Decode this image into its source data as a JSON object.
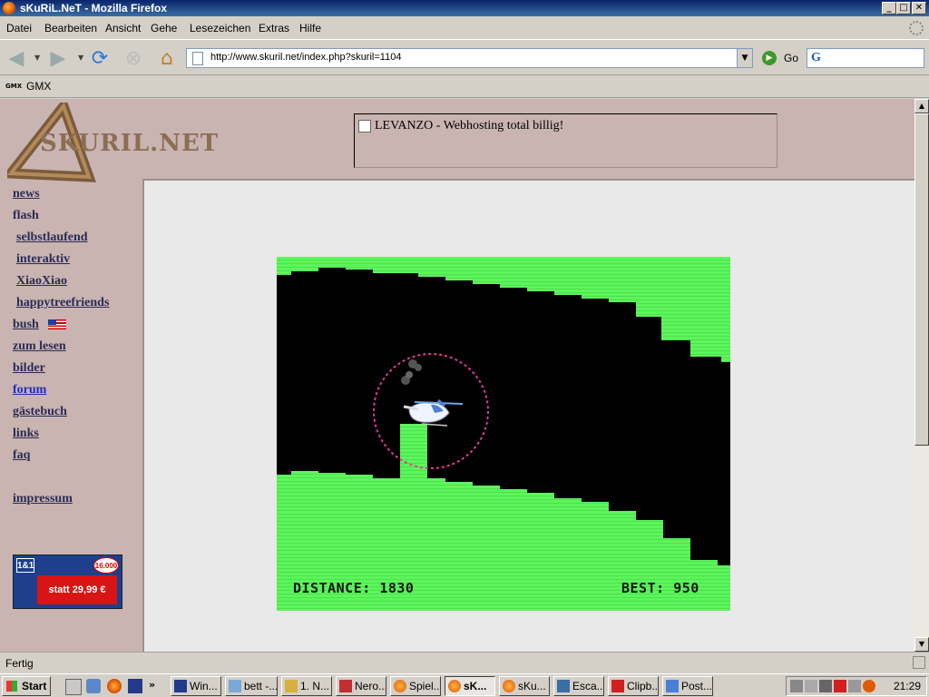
{
  "window": {
    "title": "sKuRiL.NeT - Mozilla Firefox",
    "buttons": {
      "minimize": "_",
      "maximize": "□",
      "close": "✕"
    }
  },
  "menu": [
    "Datei",
    "Bearbeiten",
    "Ansicht",
    "Gehe",
    "Lesezeichen",
    "Extras",
    "Hilfe"
  ],
  "toolbar": {
    "url": "http://www.skuril.net/index.php?skuril=1104",
    "go_label": "Go"
  },
  "bookmarks": {
    "icon_text": "GMX",
    "label": "GMX"
  },
  "page": {
    "logo_text": "SKURIL.NET",
    "ad_text": "LEVANZO - Webhosting total billig!",
    "nav": [
      "news",
      "flash",
      "selbstlaufend",
      "interaktiv",
      "XiaoXiao",
      "happytreefriends",
      "bush",
      "zum lesen",
      "bilder",
      "forum",
      "gästebuch",
      "links",
      "faq",
      "impressum"
    ],
    "ad_box": {
      "logo": "1&1",
      "badge": "16.000",
      "price": "statt 29,99 €"
    },
    "game": {
      "distance_label": "DISTANCE:",
      "distance_value": "1830",
      "best_label": "BEST:",
      "best_value": "950"
    }
  },
  "status": {
    "text": "Fertig"
  },
  "taskbar": {
    "start": "Start",
    "tasks": [
      "Win...",
      "bett -...",
      "1. N...",
      "Nero...",
      "Spiel...",
      "sK...",
      "sKu...",
      "Esca...",
      "Clipb...",
      "Post..."
    ],
    "clock": "21:29"
  },
  "colors": {
    "page_bg": "#c9b4b2",
    "cave_green": "#5cf55c",
    "link": "#2b2b55",
    "visited_link": "#1e2cc4"
  }
}
